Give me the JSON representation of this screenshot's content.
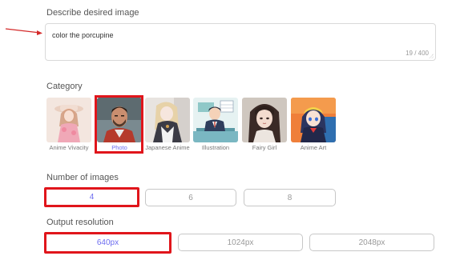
{
  "describe": {
    "label": "Describe desired image",
    "value": "color the porcupine",
    "counter": "19 / 400"
  },
  "category": {
    "label": "Category",
    "items": [
      {
        "label": "Anime Vivacity",
        "selected": false
      },
      {
        "label": "Photo",
        "selected": true
      },
      {
        "label": "Japanese Anime",
        "selected": false
      },
      {
        "label": "Illustration",
        "selected": false
      },
      {
        "label": "Fairy Girl",
        "selected": false
      },
      {
        "label": "Anime Art",
        "selected": false
      }
    ]
  },
  "num_images": {
    "label": "Number of images",
    "options": [
      "4",
      "6",
      "8"
    ],
    "selected": "4"
  },
  "resolution": {
    "label": "Output resolution",
    "options": [
      "640px",
      "1024px",
      "2048px"
    ],
    "selected": "640px"
  },
  "colors": {
    "accent": "#6d6df0",
    "highlight": "#e0151b",
    "annotation_arrow": "#d42a2a"
  }
}
